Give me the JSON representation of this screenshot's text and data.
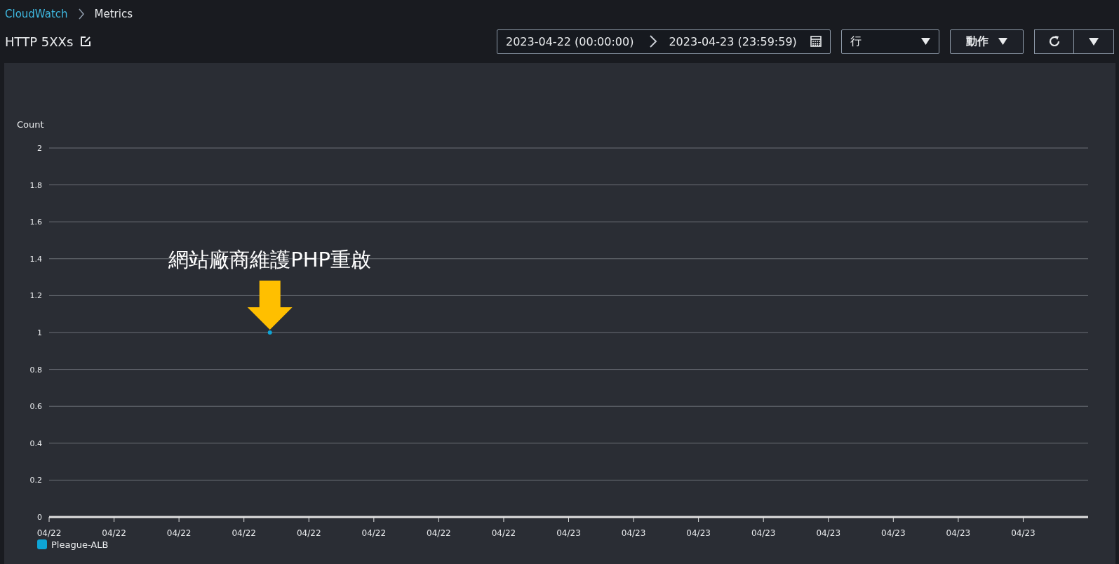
{
  "breadcrumbs": [
    {
      "label": "CloudWatch",
      "kind": "link"
    },
    {
      "label": "Metrics",
      "kind": "current"
    }
  ],
  "title": "HTTP 5XXs",
  "time_range": {
    "start": "2023-04-22 (00:00:00)",
    "end": "2023-04-23 (23:59:59)"
  },
  "view_select": {
    "value": "行"
  },
  "actions_button": {
    "label": "動作"
  },
  "chart": {
    "chart_data": {
      "type": "scatter",
      "ylabel": "Count",
      "categories": [
        "04/22",
        null,
        null,
        null,
        null,
        "04/22",
        null,
        null,
        null,
        null,
        "04/22",
        null,
        null,
        null,
        null,
        "04/22",
        null,
        null,
        null,
        null,
        "04/22",
        null,
        null,
        null,
        null,
        "04/22",
        null,
        null,
        null,
        null,
        "04/22",
        null,
        null,
        null,
        null,
        "04/22",
        null,
        null,
        null,
        null,
        "04/23",
        null,
        null,
        null,
        null,
        "04/23",
        null,
        null,
        null,
        null,
        "04/23",
        null,
        null,
        null,
        null,
        "04/23",
        null,
        null,
        null,
        null,
        "04/23",
        null,
        null,
        null,
        null,
        "04/23",
        null,
        null,
        null,
        null,
        "04/23",
        null,
        null,
        null,
        null,
        "04/23",
        null,
        null,
        null,
        null,
        null
      ],
      "series": [
        {
          "name": "Pleague-ALB",
          "color": "#0ea5d6",
          "values": [
            null,
            null,
            null,
            null,
            null,
            null,
            null,
            null,
            null,
            null,
            null,
            null,
            null,
            null,
            null,
            null,
            null,
            1,
            null,
            null,
            null,
            null,
            null,
            null,
            null,
            null,
            null,
            null,
            null,
            null,
            null,
            null,
            null,
            null,
            null,
            null,
            null,
            null,
            null,
            null,
            null,
            null,
            null,
            null,
            null,
            null,
            null,
            null,
            null,
            null,
            null,
            null,
            null,
            null,
            null,
            null,
            null,
            null,
            null,
            null,
            null,
            null,
            null,
            null,
            null,
            null,
            null,
            null,
            null,
            null,
            null,
            null,
            null,
            null,
            null,
            null,
            null,
            null,
            null,
            null,
            null
          ]
        }
      ],
      "ylim": [
        0,
        2
      ],
      "grid": true,
      "yticks": [
        0,
        0.2,
        0.4,
        0.6,
        0.8,
        1,
        1.2,
        1.4,
        1.6,
        1.8,
        2
      ],
      "annotations": [
        {
          "text": "網站廠商維護PHP重啟",
          "y": 1
        }
      ]
    }
  }
}
